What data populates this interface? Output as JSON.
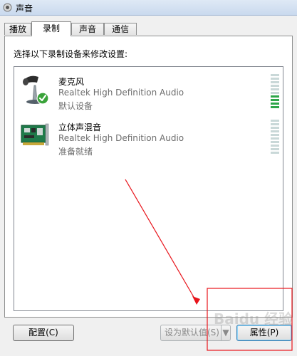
{
  "window": {
    "title": "声音"
  },
  "tabs": [
    {
      "label": "播放"
    },
    {
      "label": "录制"
    },
    {
      "label": "声音"
    },
    {
      "label": "通信"
    }
  ],
  "panel": {
    "instruction": "选择以下录制设备来修改设置:",
    "devices": [
      {
        "name": "麦克风",
        "description": "Realtek High Definition Audio",
        "status": "默认设备",
        "icon": "microphone-icon",
        "default": true,
        "level_segments_lit": 4
      },
      {
        "name": "立体声混音",
        "description": "Realtek High Definition Audio",
        "status": "准备就绪",
        "icon": "sound-card-icon",
        "default": false,
        "level_segments_lit": 0
      }
    ]
  },
  "buttons": {
    "configure": "配置(C)",
    "set_default": "设为默认值(S)",
    "set_default_arrow": "▼",
    "properties": "属性(P)"
  },
  "watermark": "Baidu 经验",
  "colors": {
    "level_on": "#2ea64a",
    "level_off": "#c9d8d8",
    "annotation": "#e8141b"
  }
}
